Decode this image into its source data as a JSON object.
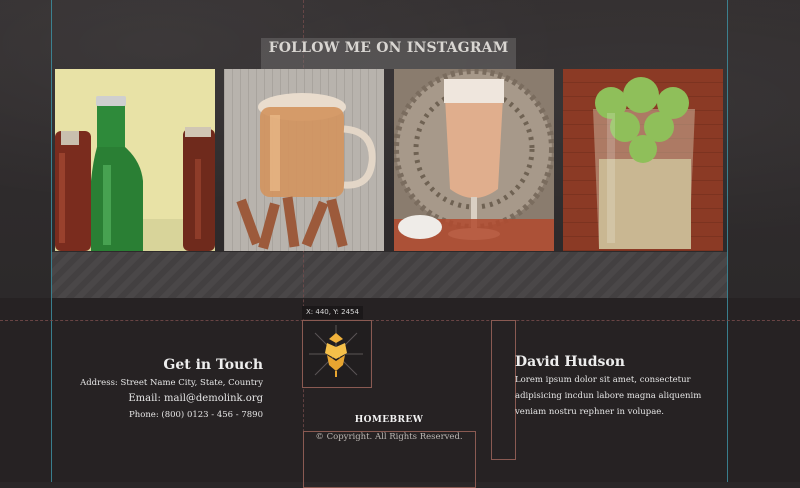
{
  "instagram": {
    "title": "FOLLOW ME ON INSTAGRAM",
    "photos": [
      {
        "name": "beer-bottles-photo"
      },
      {
        "name": "beer-mug-pretzels-photo"
      },
      {
        "name": "beer-glass-basket-photo"
      },
      {
        "name": "hops-grain-glass-photo"
      }
    ]
  },
  "editor": {
    "coord_label": "X: 440, Y: 2454"
  },
  "footer": {
    "contact": {
      "title": "Get in Touch",
      "address": "Address: Street Name City, State, Country",
      "email": "Email: mail@demolink.org",
      "phone": "Phone: (800) 0123 - 456 - 7890"
    },
    "brand": "HOMEBREW",
    "copyright": "© Copyright. All Rights Reserved.",
    "about": {
      "title": "David Hudson",
      "text": "Lorem ipsum dolor sit amet, consectetur adipisicing incdun labore magna aliquenim veniam nostru rephner in volupae."
    }
  },
  "colors": {
    "background": "#2a2728",
    "footer": "#262223",
    "guide": "#3d8ea0",
    "selection": "#8a5a52"
  }
}
